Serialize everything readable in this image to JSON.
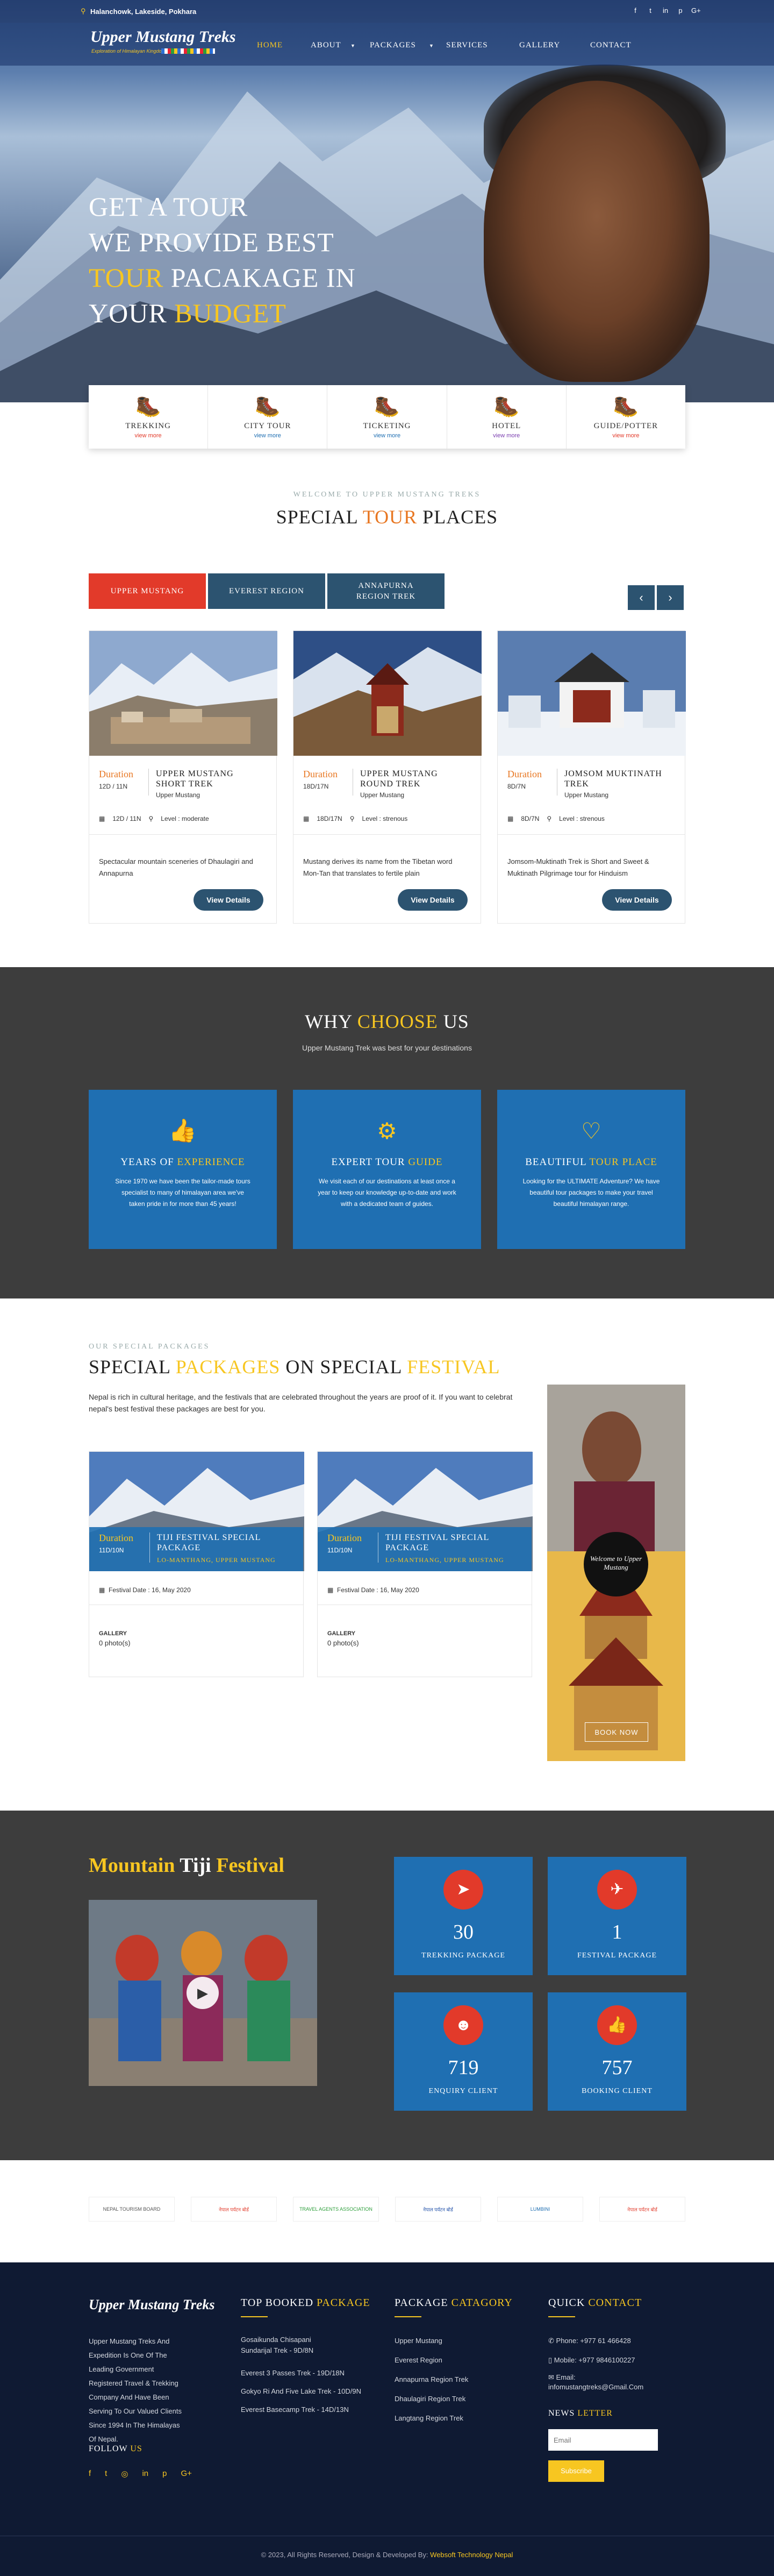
{
  "topbar": {
    "address": "Halanchowk, Lakeside, Pokhara",
    "social": [
      "f",
      "t",
      "in",
      "p",
      "G+"
    ]
  },
  "brand": {
    "name": "Upper Mustang Treks",
    "tagline": "Exploration of Himalayan Kingdom"
  },
  "nav": [
    "HOME",
    "ABOUT",
    "PACKAGES",
    "SERVICES",
    "GALLERY",
    "CONTACT"
  ],
  "hero": {
    "l1": "GET A TOUR",
    "l2": "WE PROVIDE BEST",
    "l3a": "TOUR",
    "l3b": " PACAKAGE IN",
    "l4a": "YOUR ",
    "l4b": "BUDGET"
  },
  "services": [
    {
      "name": "TREKKING",
      "link": "view more"
    },
    {
      "name": "CITY TOUR",
      "link": "view more"
    },
    {
      "name": "TICKETING",
      "link": "view more"
    },
    {
      "name": "HOTEL",
      "link": "view more"
    },
    {
      "name": "GUIDE/POTTER",
      "link": "view more"
    }
  ],
  "places": {
    "eyebrow": "WELCOME TO UPPER MUSTANG TREKS",
    "t1": "SPECIAL ",
    "t2": "TOUR",
    "t3": " PLACES",
    "tabs": [
      "UPPER MUSTANG",
      "EVEREST REGION",
      "ANNAPURNA REGION TREK"
    ],
    "cards": [
      {
        "dur_label": "Duration",
        "dur": "12D / 11N",
        "title": "UPPER MUSTANG SHORT TREK",
        "region": "Upper Mustang",
        "meta": "12D / 11N",
        "level": "Level : moderate",
        "desc": "Spectacular mountain sceneries of Dhaulagiri and Annapurna",
        "btn": "View Details"
      },
      {
        "dur_label": "Duration",
        "dur": "18D/17N",
        "title": "UPPER MUSTANG ROUND TREK",
        "region": "Upper Mustang",
        "meta": "18D/17N",
        "level": "Level : strenous",
        "desc": "Mustang derives its name from the Tibetan word Mon-Tan that translates to fertile plain",
        "btn": "View Details"
      },
      {
        "dur_label": "Duration",
        "dur": "8D/7N",
        "title": "JOMSOM MUKTINATH TREK",
        "region": "Upper Mustang",
        "meta": "8D/7N",
        "level": "Level : strenous",
        "desc": "Jomsom-Muktinath Trek is Short and Sweet & Muktinath Pilgrimage tour for Hinduism",
        "btn": "View Details"
      }
    ]
  },
  "why": {
    "t1": "WHY ",
    "t2": "CHOOSE",
    "t3": " US",
    "sub": "Upper Mustang Trek was best for your destinations",
    "boxes": [
      {
        "a": "YEARS OF ",
        "b": "EXPERIENCE",
        "desc": "Since 1970 we have been the tailor-made tours specialist to many of himalayan area we've taken pride in for more than 45 years!"
      },
      {
        "a": "EXPERT TOUR ",
        "b": "GUIDE",
        "desc": "We visit each of our destinations at least once a year to keep our knowledge up-to-date and work with a dedicated team of guides."
      },
      {
        "a": "BEAUTIFUL ",
        "b": "TOUR PLACE",
        "desc": "Looking for the ULTIMATE Adventure? We have beautiful tour packages to make your travel beautiful himalayan range."
      }
    ]
  },
  "special": {
    "eyebrow": "OUR SPECIAL PACKAGES",
    "t1": "SPECIAL ",
    "t2": "PACKAGES",
    "t3": " ON SPECIAL ",
    "t4": "FESTIVAL",
    "desc": "Nepal is rich in cultural heritage, and the festivals that are celebrated throughout the years are proof of it. If you want to celebrat nepal's best festival these packages are best for you.",
    "cards": [
      {
        "dur_label": "Duration",
        "dur": "11D/10N",
        "title": "TIJI FESTIVAL SPECIAL PACKAGE",
        "sub": "LO-MANTHANG, UPPER MUSTANG",
        "date": "Festival Date : 16, May 2020",
        "gal": "GALLERY",
        "photos": "0 photo(s)"
      },
      {
        "dur_label": "Duration",
        "dur": "11D/10N",
        "title": "TIJI FESTIVAL SPECIAL PACKAGE",
        "sub": "LO-MANTHANG, UPPER MUSTANG",
        "date": "Festival Date : 16, May 2020",
        "gal": "GALLERY",
        "photos": "0 photo(s)"
      }
    ],
    "banner": {
      "welcome": "Welcome to Upper Mustang",
      "btn": "BOOK NOW"
    }
  },
  "tiji": {
    "t1": "Mountain ",
    "t2": "Tiji",
    "t3": " Festival"
  },
  "stats": [
    {
      "num": "30",
      "label": "TREKKING PACKAGE",
      "icon": "➤"
    },
    {
      "num": "1",
      "label": "FESTIVAL PACKAGE",
      "icon": "✈"
    },
    {
      "num": "719",
      "label": "ENQUIRY CLIENT",
      "icon": "☻"
    },
    {
      "num": "757",
      "label": "BOOKING CLIENT",
      "icon": "👍"
    }
  ],
  "partners": [
    "NEPAL TOURISM BOARD",
    "नेपाल पर्यटन बोर्ड",
    "TRAVEL AGENTS ASSOCIATION",
    "नेपाल पर्यटन बोर्ड",
    "LUMBINI",
    "नेपाल पर्यटन बोर्ड"
  ],
  "footer": {
    "about": "Upper Mustang Treks And Expedition Is One Of The Leading Government Registered Travel & Trekking Company And Have Been Serving To Our Valued Clients Since 1994 In The Himalayas Of Nepal.",
    "follow_a": "FOLLOW ",
    "follow_b": "US",
    "top_a": "TOP BOOKED ",
    "top_b": "PACKAGE",
    "top": [
      "Gosaikunda Chisapani Sundarijal Trek - 9D/8N",
      "Everest 3 Passes Trek - 19D/18N",
      "Gokyo Ri And Five Lake Trek - 10D/9N",
      "Everest Basecamp Trek - 14D/13N"
    ],
    "cat_a": "PACKAGE ",
    "cat_b": "CATAGORY",
    "cats": [
      "Upper Mustang",
      "Everest Region",
      "Annapurna Region Trek",
      "Dhaulagiri Region Trek",
      "Langtang Region Trek"
    ],
    "qc_a": "QUICK ",
    "qc_b": "CONTACT",
    "phone": "Phone: +977 61 466428",
    "mobile": "Mobile: +977 9846100227",
    "email_l": "Email:",
    "email": "infomustangtreks@Gmail.Com",
    "news_a": "NEWS ",
    "news_b": "LETTER",
    "placeholder": "Email",
    "subscribe": "Subscribe",
    "copy": "© 2023, All Rights Reserved, Design & Developed By: ",
    "dev": "Websoft Technology Nepal"
  },
  "colors": {
    "accent": "#f7c621",
    "blue": "#1f6fb2",
    "red": "#e23a2a",
    "navy": "#0f1a33"
  }
}
